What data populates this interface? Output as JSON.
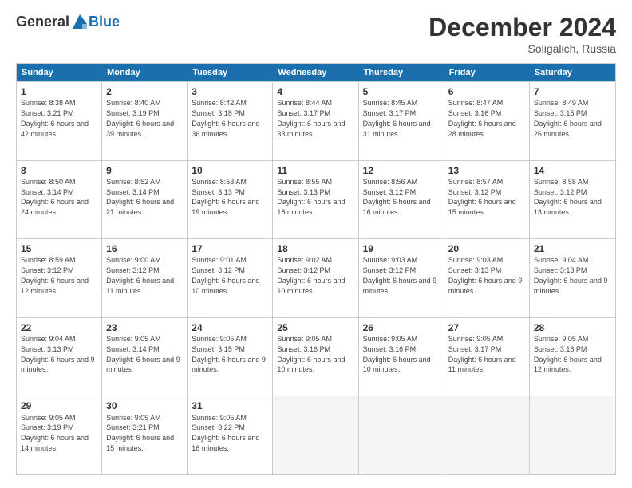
{
  "header": {
    "logo_general": "General",
    "logo_blue": "Blue",
    "month_title": "December 2024",
    "location": "Soligalich, Russia"
  },
  "days_of_week": [
    "Sunday",
    "Monday",
    "Tuesday",
    "Wednesday",
    "Thursday",
    "Friday",
    "Saturday"
  ],
  "weeks": [
    [
      {
        "day": "1",
        "sunrise": "Sunrise: 8:38 AM",
        "sunset": "Sunset: 3:21 PM",
        "daylight": "Daylight: 6 hours and 42 minutes."
      },
      {
        "day": "2",
        "sunrise": "Sunrise: 8:40 AM",
        "sunset": "Sunset: 3:19 PM",
        "daylight": "Daylight: 6 hours and 39 minutes."
      },
      {
        "day": "3",
        "sunrise": "Sunrise: 8:42 AM",
        "sunset": "Sunset: 3:18 PM",
        "daylight": "Daylight: 6 hours and 36 minutes."
      },
      {
        "day": "4",
        "sunrise": "Sunrise: 8:44 AM",
        "sunset": "Sunset: 3:17 PM",
        "daylight": "Daylight: 6 hours and 33 minutes."
      },
      {
        "day": "5",
        "sunrise": "Sunrise: 8:45 AM",
        "sunset": "Sunset: 3:17 PM",
        "daylight": "Daylight: 6 hours and 31 minutes."
      },
      {
        "day": "6",
        "sunrise": "Sunrise: 8:47 AM",
        "sunset": "Sunset: 3:16 PM",
        "daylight": "Daylight: 6 hours and 28 minutes."
      },
      {
        "day": "7",
        "sunrise": "Sunrise: 8:49 AM",
        "sunset": "Sunset: 3:15 PM",
        "daylight": "Daylight: 6 hours and 26 minutes."
      }
    ],
    [
      {
        "day": "8",
        "sunrise": "Sunrise: 8:50 AM",
        "sunset": "Sunset: 3:14 PM",
        "daylight": "Daylight: 6 hours and 24 minutes."
      },
      {
        "day": "9",
        "sunrise": "Sunrise: 8:52 AM",
        "sunset": "Sunset: 3:14 PM",
        "daylight": "Daylight: 6 hours and 21 minutes."
      },
      {
        "day": "10",
        "sunrise": "Sunrise: 8:53 AM",
        "sunset": "Sunset: 3:13 PM",
        "daylight": "Daylight: 6 hours and 19 minutes."
      },
      {
        "day": "11",
        "sunrise": "Sunrise: 8:55 AM",
        "sunset": "Sunset: 3:13 PM",
        "daylight": "Daylight: 6 hours and 18 minutes."
      },
      {
        "day": "12",
        "sunrise": "Sunrise: 8:56 AM",
        "sunset": "Sunset: 3:12 PM",
        "daylight": "Daylight: 6 hours and 16 minutes."
      },
      {
        "day": "13",
        "sunrise": "Sunrise: 8:57 AM",
        "sunset": "Sunset: 3:12 PM",
        "daylight": "Daylight: 6 hours and 15 minutes."
      },
      {
        "day": "14",
        "sunrise": "Sunrise: 8:58 AM",
        "sunset": "Sunset: 3:12 PM",
        "daylight": "Daylight: 6 hours and 13 minutes."
      }
    ],
    [
      {
        "day": "15",
        "sunrise": "Sunrise: 8:59 AM",
        "sunset": "Sunset: 3:12 PM",
        "daylight": "Daylight: 6 hours and 12 minutes."
      },
      {
        "day": "16",
        "sunrise": "Sunrise: 9:00 AM",
        "sunset": "Sunset: 3:12 PM",
        "daylight": "Daylight: 6 hours and 11 minutes."
      },
      {
        "day": "17",
        "sunrise": "Sunrise: 9:01 AM",
        "sunset": "Sunset: 3:12 PM",
        "daylight": "Daylight: 6 hours and 10 minutes."
      },
      {
        "day": "18",
        "sunrise": "Sunrise: 9:02 AM",
        "sunset": "Sunset: 3:12 PM",
        "daylight": "Daylight: 6 hours and 10 minutes."
      },
      {
        "day": "19",
        "sunrise": "Sunrise: 9:03 AM",
        "sunset": "Sunset: 3:12 PM",
        "daylight": "Daylight: 6 hours and 9 minutes."
      },
      {
        "day": "20",
        "sunrise": "Sunrise: 9:03 AM",
        "sunset": "Sunset: 3:13 PM",
        "daylight": "Daylight: 6 hours and 9 minutes."
      },
      {
        "day": "21",
        "sunrise": "Sunrise: 9:04 AM",
        "sunset": "Sunset: 3:13 PM",
        "daylight": "Daylight: 6 hours and 9 minutes."
      }
    ],
    [
      {
        "day": "22",
        "sunrise": "Sunrise: 9:04 AM",
        "sunset": "Sunset: 3:13 PM",
        "daylight": "Daylight: 6 hours and 9 minutes."
      },
      {
        "day": "23",
        "sunrise": "Sunrise: 9:05 AM",
        "sunset": "Sunset: 3:14 PM",
        "daylight": "Daylight: 6 hours and 9 minutes."
      },
      {
        "day": "24",
        "sunrise": "Sunrise: 9:05 AM",
        "sunset": "Sunset: 3:15 PM",
        "daylight": "Daylight: 6 hours and 9 minutes."
      },
      {
        "day": "25",
        "sunrise": "Sunrise: 9:05 AM",
        "sunset": "Sunset: 3:16 PM",
        "daylight": "Daylight: 6 hours and 10 minutes."
      },
      {
        "day": "26",
        "sunrise": "Sunrise: 9:05 AM",
        "sunset": "Sunset: 3:16 PM",
        "daylight": "Daylight: 6 hours and 10 minutes."
      },
      {
        "day": "27",
        "sunrise": "Sunrise: 9:05 AM",
        "sunset": "Sunset: 3:17 PM",
        "daylight": "Daylight: 6 hours and 11 minutes."
      },
      {
        "day": "28",
        "sunrise": "Sunrise: 9:05 AM",
        "sunset": "Sunset: 3:18 PM",
        "daylight": "Daylight: 6 hours and 12 minutes."
      }
    ],
    [
      {
        "day": "29",
        "sunrise": "Sunrise: 9:05 AM",
        "sunset": "Sunset: 3:19 PM",
        "daylight": "Daylight: 6 hours and 14 minutes."
      },
      {
        "day": "30",
        "sunrise": "Sunrise: 9:05 AM",
        "sunset": "Sunset: 3:21 PM",
        "daylight": "Daylight: 6 hours and 15 minutes."
      },
      {
        "day": "31",
        "sunrise": "Sunrise: 9:05 AM",
        "sunset": "Sunset: 3:22 PM",
        "daylight": "Daylight: 6 hours and 16 minutes."
      },
      {
        "day": "",
        "sunrise": "",
        "sunset": "",
        "daylight": ""
      },
      {
        "day": "",
        "sunrise": "",
        "sunset": "",
        "daylight": ""
      },
      {
        "day": "",
        "sunrise": "",
        "sunset": "",
        "daylight": ""
      },
      {
        "day": "",
        "sunrise": "",
        "sunset": "",
        "daylight": ""
      }
    ]
  ]
}
